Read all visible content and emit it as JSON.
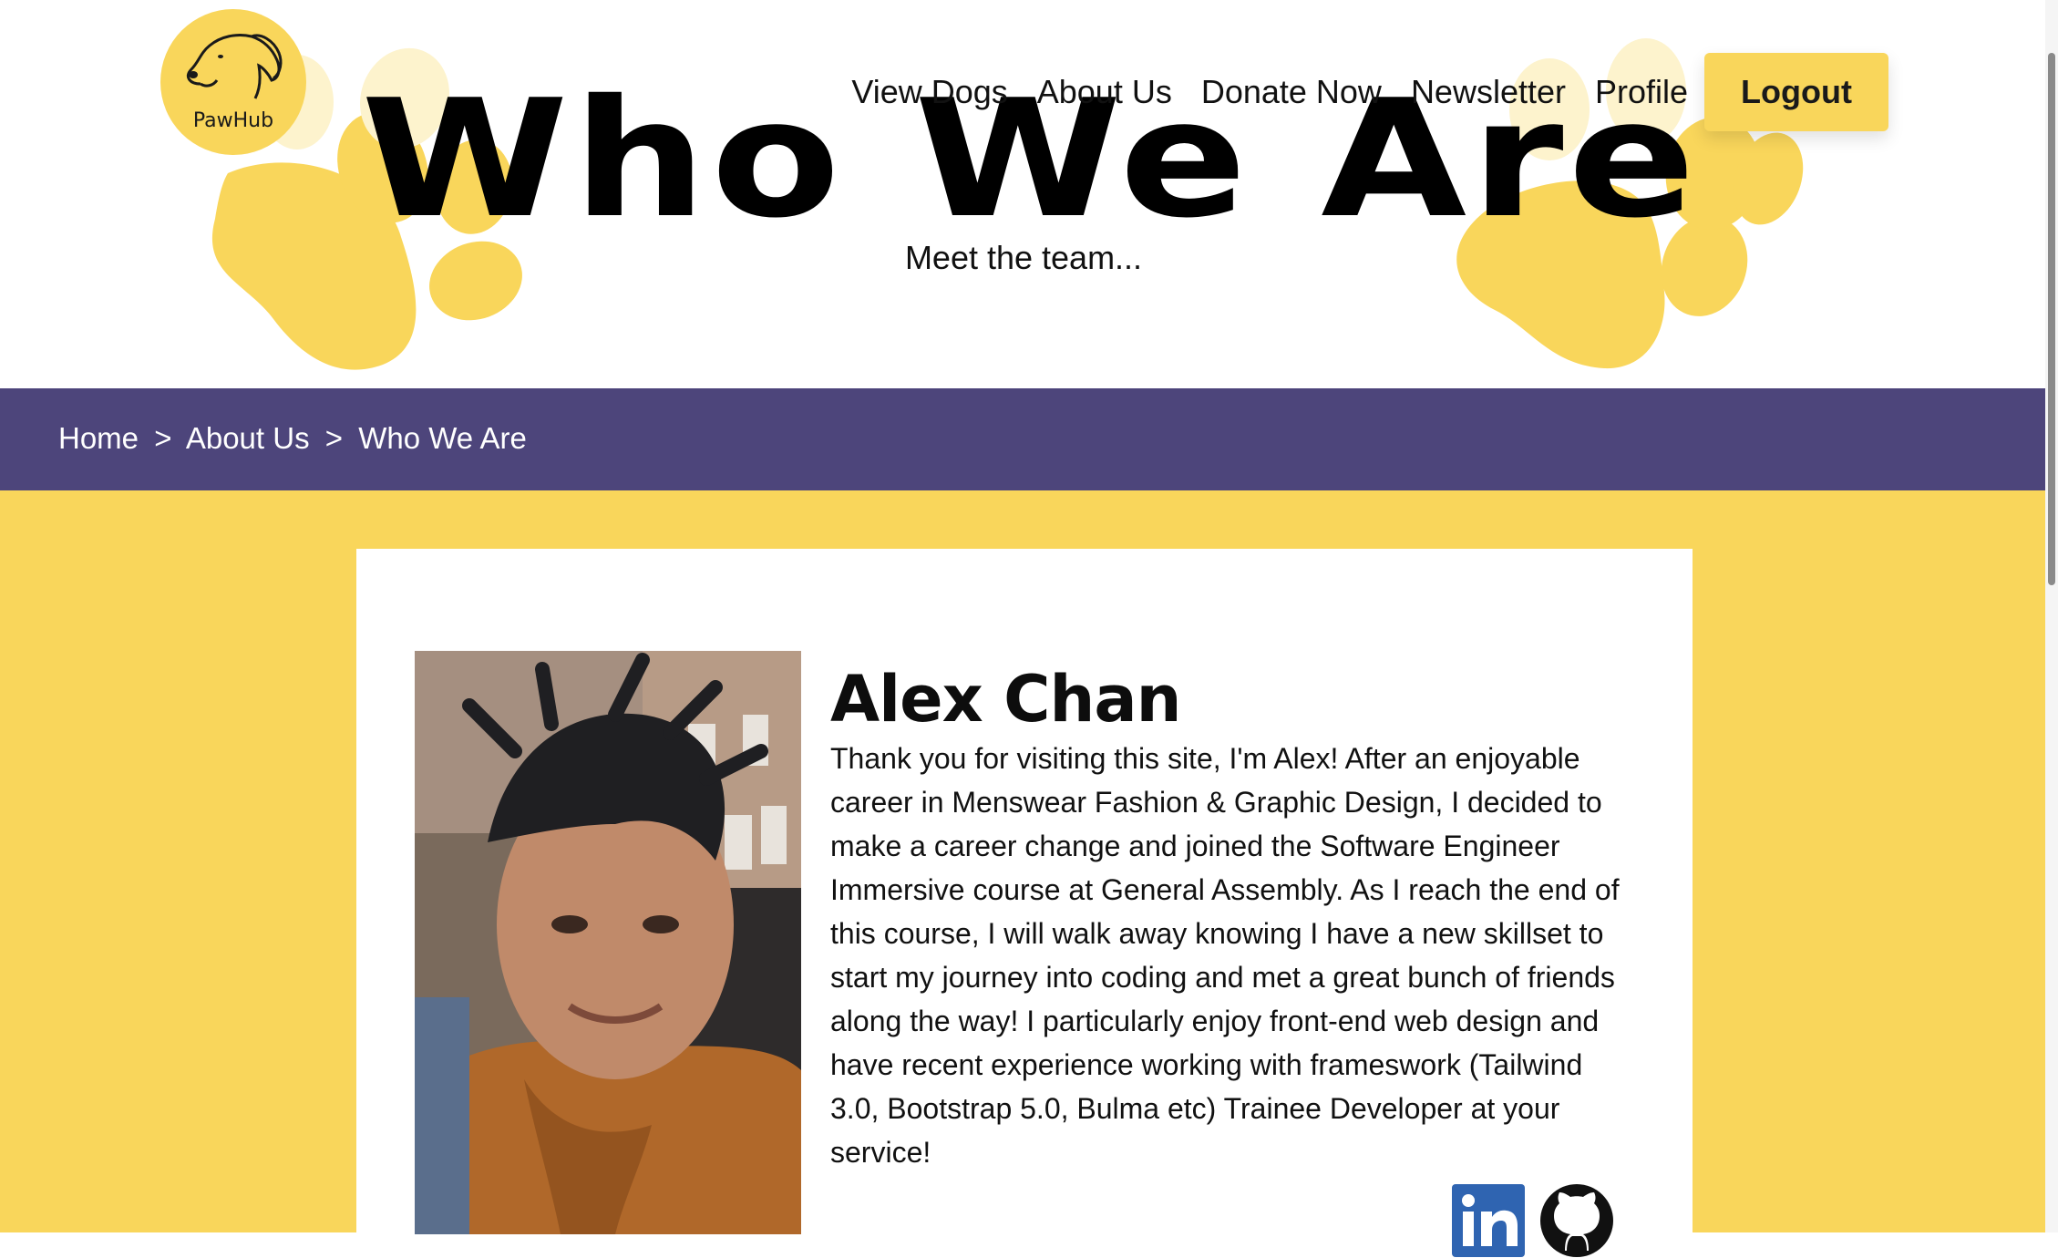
{
  "brand": {
    "name": "PawHub"
  },
  "nav": {
    "items": [
      {
        "label": "View Dogs"
      },
      {
        "label": "About Us"
      },
      {
        "label": "Donate Now"
      },
      {
        "label": "Newsletter"
      },
      {
        "label": "Profile"
      }
    ],
    "logout_label": "Logout"
  },
  "hero": {
    "title": "Who We Are",
    "subtitle": "Meet the team..."
  },
  "breadcrumb": {
    "home": "Home",
    "about": "About Us",
    "current": "Who We Are",
    "separator": ">"
  },
  "member": {
    "name": "Alex Chan",
    "bio": "Thank you for visiting this site, I'm Alex! After an enjoyable career in Menswear Fashion & Graphic Design, I decided to make a career change and joined the Software Engineer Immersive course at General Assembly. As I reach the end of this course, I will walk away knowing I have a new skillset to start my journey into coding and met a great bunch of friends along the way! I particularly enjoy front-end web design and have recent experience working with frameswork (Tailwind 3.0, Bootstrap 5.0, Bulma etc) Trainee Developer at your service!"
  },
  "social": {
    "icons": [
      "linkedin-icon",
      "github-icon"
    ]
  },
  "colors": {
    "accent": "#f9d65b",
    "breadcrumb_bg": "#4d457b",
    "title_top": "#c9c9c9"
  }
}
